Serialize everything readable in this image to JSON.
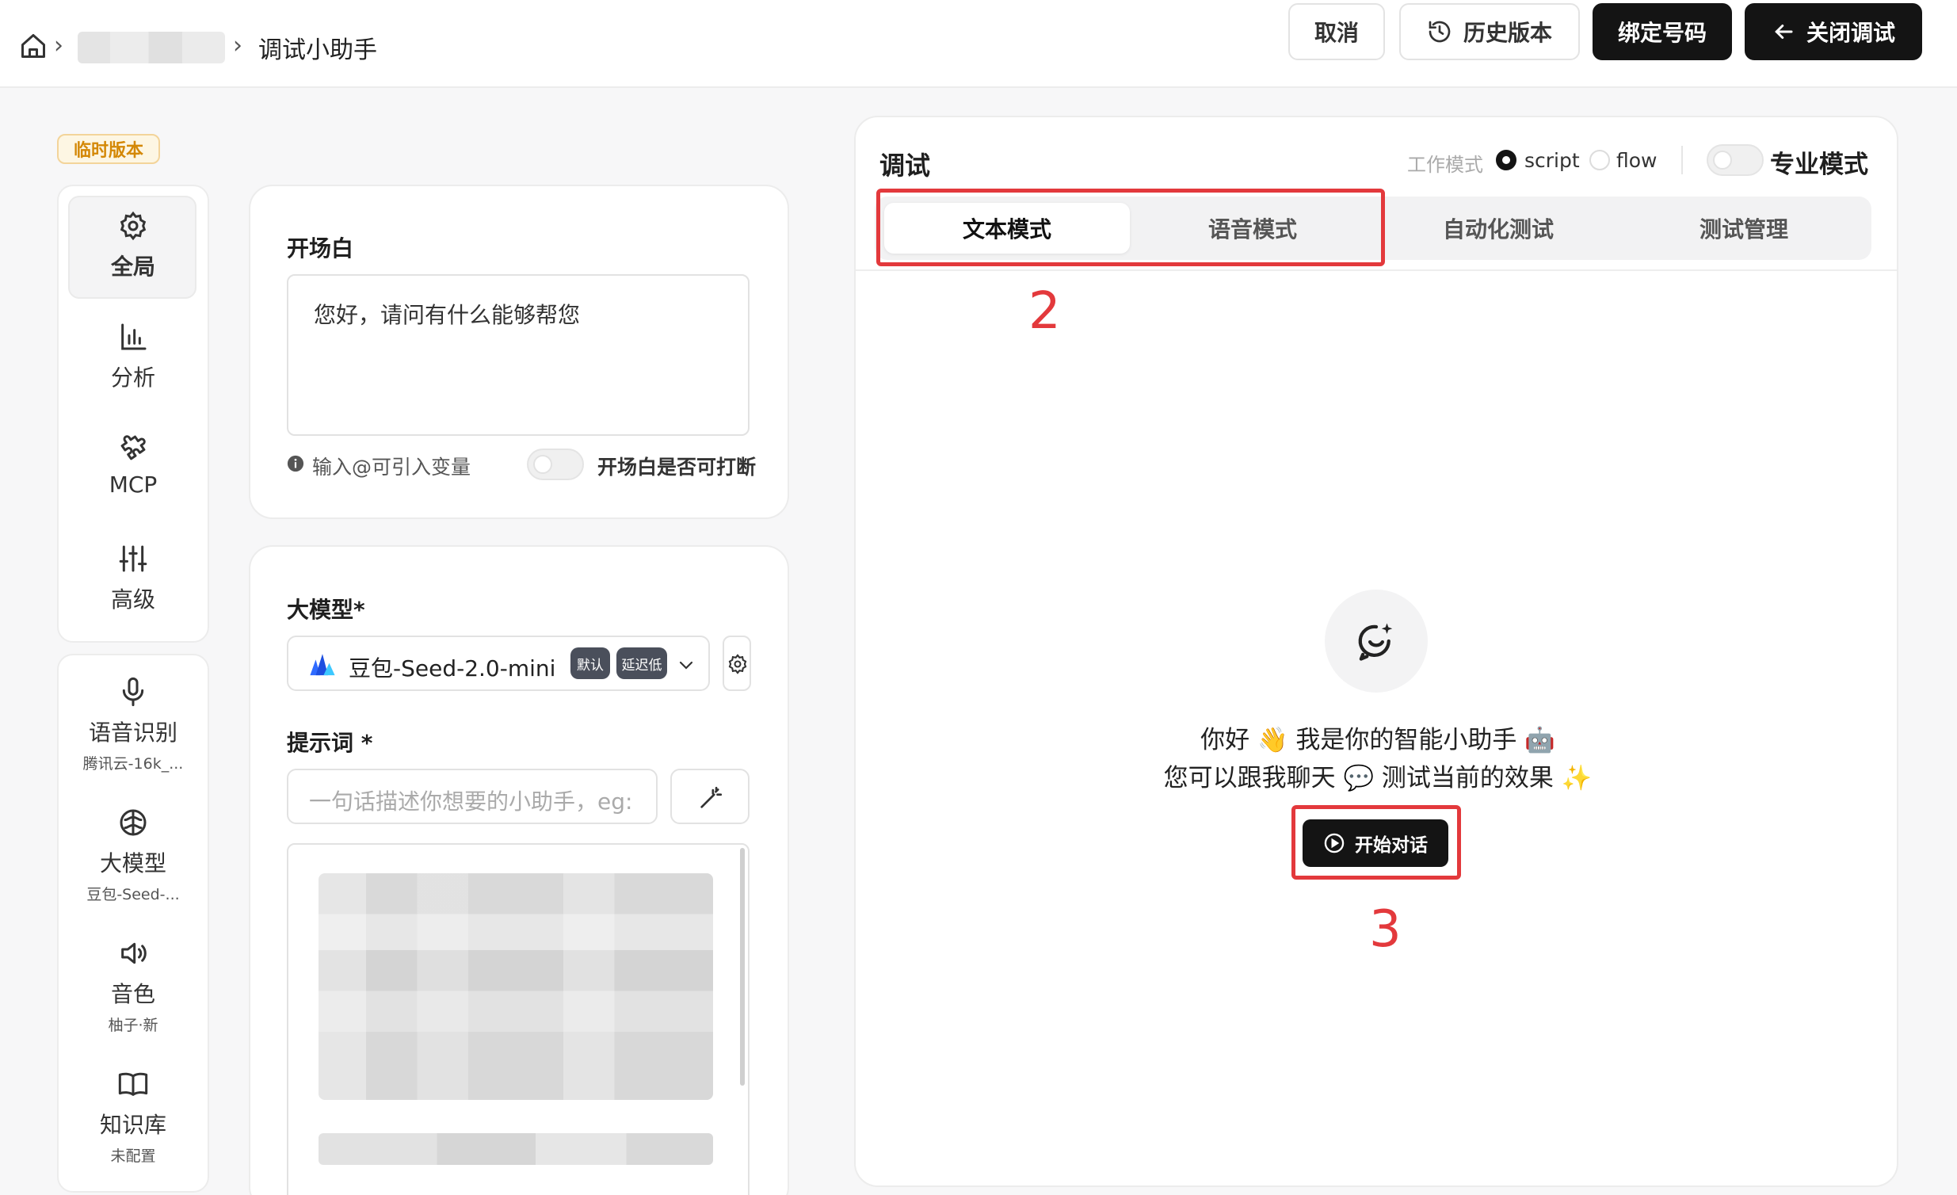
{
  "header": {
    "breadcrumb_current": "调试小助手",
    "buttons": {
      "cancel": "取消",
      "history": "历史版本",
      "bind_number": "绑定号码",
      "close_debug": "关闭调试"
    }
  },
  "left": {
    "version_badge": "临时版本",
    "nav_top": [
      {
        "label": "全局",
        "icon": "gear-icon"
      },
      {
        "label": "分析",
        "icon": "bar-chart-icon"
      },
      {
        "label": "MCP",
        "icon": "puzzle-icon"
      },
      {
        "label": "高级",
        "icon": "sliders-icon"
      }
    ],
    "nav_bottom": [
      {
        "label": "语音识别",
        "sub": "腾讯云-16k_...",
        "icon": "microphone-icon"
      },
      {
        "label": "大模型",
        "sub": "豆包-Seed-...",
        "icon": "brain-icon"
      },
      {
        "label": "音色",
        "sub": "柚子·新",
        "icon": "speaker-icon"
      },
      {
        "label": "知识库",
        "sub": "未配置",
        "icon": "book-icon"
      }
    ]
  },
  "opening": {
    "title": "开场白",
    "text": "您好，请问有什么能够帮您",
    "hint": "输入@可引入变量",
    "interrupt_label": "开场白是否可打断"
  },
  "model": {
    "title": "大模型*",
    "selected": "豆包-Seed-2.0-mini",
    "tags": [
      "默认",
      "延迟低"
    ],
    "prompt_title": "提示词 *",
    "prompt_placeholder": "一句话描述你想要的小助手，eg:"
  },
  "debug": {
    "title": "调试",
    "work_mode_label": "工作模式",
    "mode_script": "script",
    "mode_flow": "flow",
    "pro_mode_label": "专业模式",
    "tabs": [
      "文本模式",
      "语音模式",
      "自动化测试",
      "测试管理"
    ],
    "greeting_line1": "你好 👋 我是你的智能小助手 🤖",
    "greeting_line2": "您可以跟我聊天 💬 测试当前的效果 ✨",
    "start_button": "开始对话",
    "annotation_2": "2",
    "annotation_3": "3"
  },
  "colors": {
    "accent_dark": "#141414",
    "annotation_red": "#e3393c",
    "badge_orange": "#d48806"
  }
}
